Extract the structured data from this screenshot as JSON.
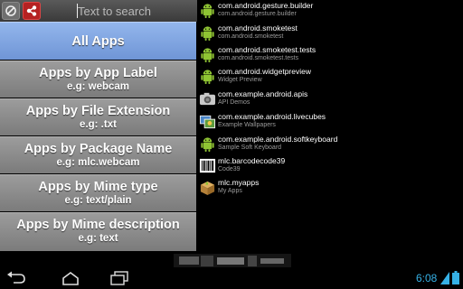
{
  "search": {
    "placeholder": "Text to search"
  },
  "menu": [
    {
      "label": "All Apps",
      "sub": ""
    },
    {
      "label": "Apps by App Label",
      "sub": "e.g: webcam"
    },
    {
      "label": "Apps by File Extension",
      "sub": "e.g: .txt"
    },
    {
      "label": "Apps by Package Name",
      "sub": "e.g: mlc.webcam"
    },
    {
      "label": "Apps by Mime type",
      "sub": "e.g: text/plain"
    },
    {
      "label": "Apps by Mime description",
      "sub": "e.g: text"
    }
  ],
  "apps": [
    {
      "name": "com.android.gesture.builder",
      "desc": "com.android.gesture.builder",
      "icon": "android-robot-icon"
    },
    {
      "name": "com.android.smoketest",
      "desc": "com.android.smoketest",
      "icon": "android-robot-icon"
    },
    {
      "name": "com.android.smoketest.tests",
      "desc": "com.android.smoketest.tests",
      "icon": "android-robot-icon"
    },
    {
      "name": "com.android.widgetpreview",
      "desc": "Widget Preview",
      "icon": "android-robot-icon"
    },
    {
      "name": "com.example.android.apis",
      "desc": "API Demos",
      "icon": "camera-icon"
    },
    {
      "name": "com.example.android.livecubes",
      "desc": "Example Wallpapers",
      "icon": "wallpaper-icon"
    },
    {
      "name": "com.example.android.softkeyboard",
      "desc": "Sample Soft Keyboard",
      "icon": "android-robot-icon"
    },
    {
      "name": "mlc.barcodecode39",
      "desc": "Code39",
      "icon": "barcode-icon"
    },
    {
      "name": "mlc.myapps",
      "desc": "My Apps",
      "icon": "package-box-icon"
    }
  ],
  "status": {
    "time": "6:08"
  },
  "colors": {
    "active_item": "#7fa5e2",
    "menu_item": "#8a8a8a",
    "clock": "#36b1e6",
    "android_green": "#8fc433"
  }
}
